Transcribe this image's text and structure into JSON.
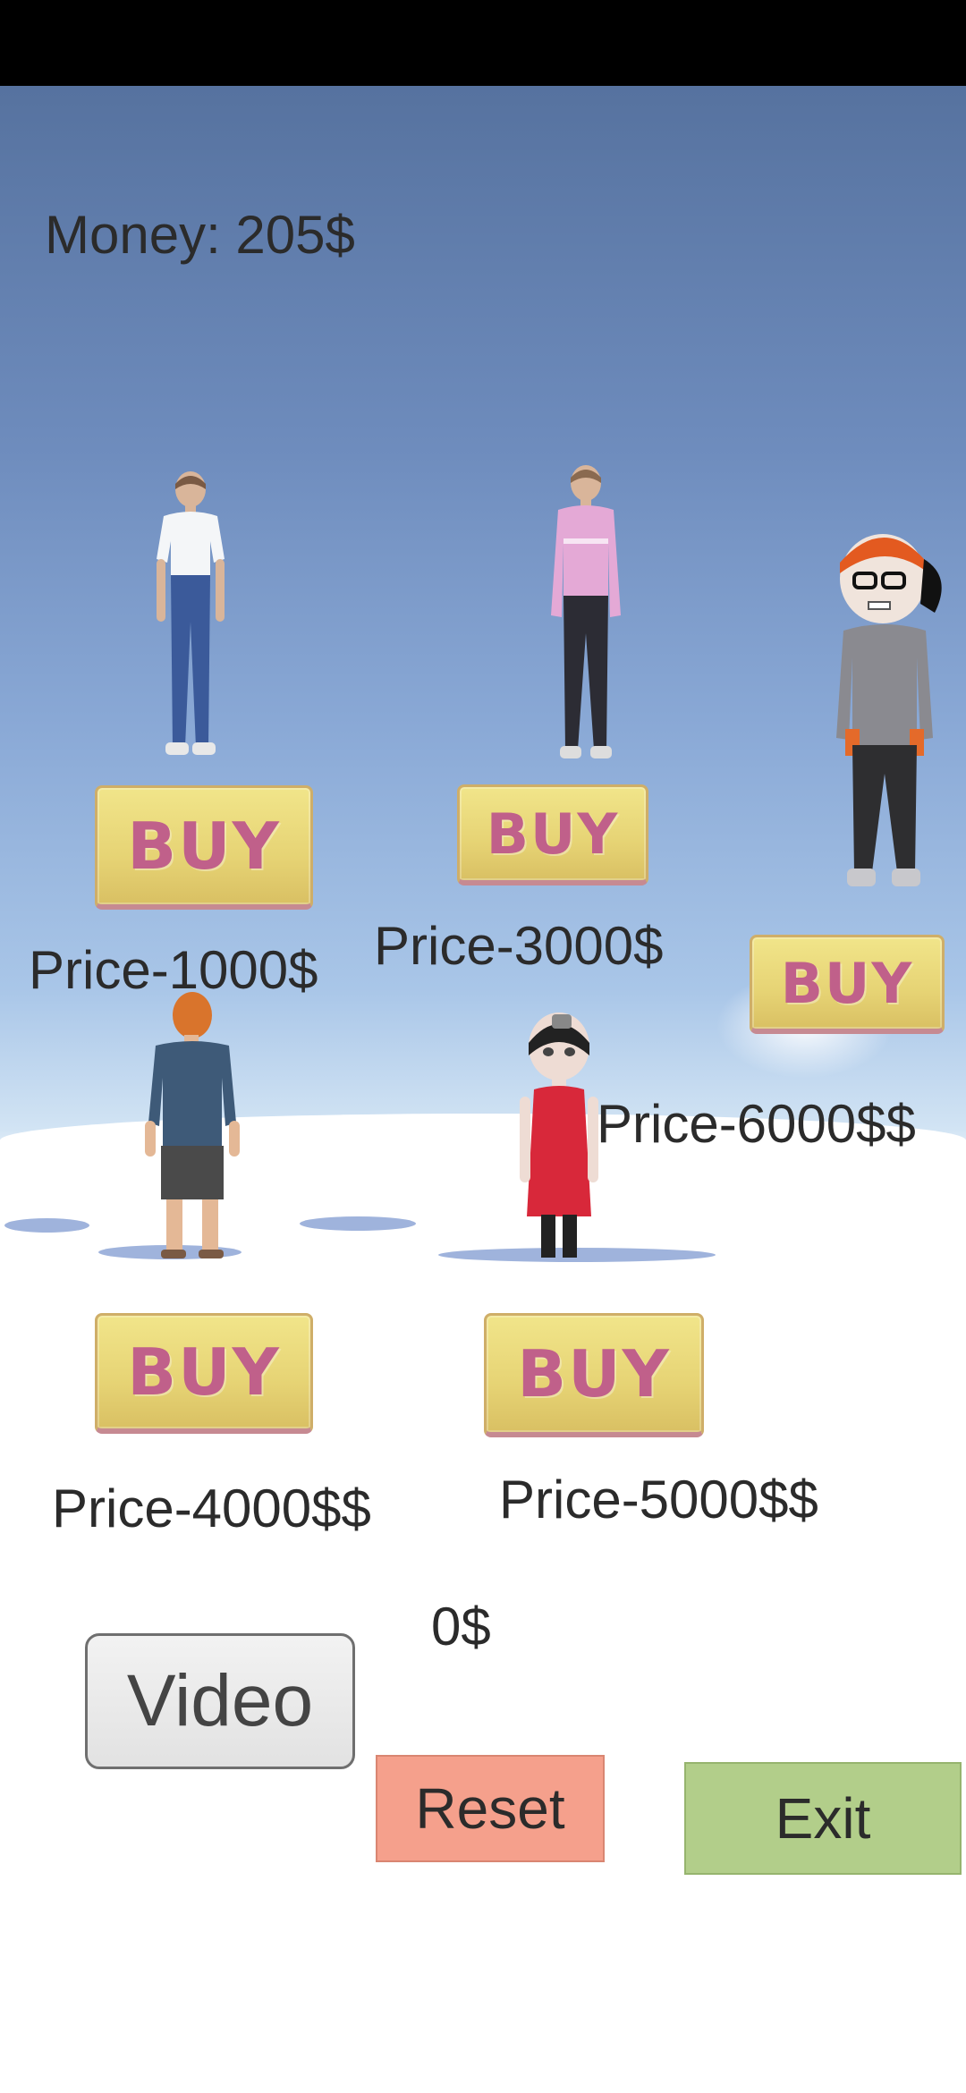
{
  "hud": {
    "money": "Money: 205$",
    "earned": "0$"
  },
  "shop": [
    {
      "buy_label": "BUY",
      "price": "Price-1000$"
    },
    {
      "buy_label": "BUY",
      "price": "Price-3000$"
    },
    {
      "buy_label": "BUY",
      "price": "Price-6000$$"
    },
    {
      "buy_label": "BUY",
      "price": "Price-4000$$"
    },
    {
      "buy_label": "BUY",
      "price": "Price-5000$$"
    }
  ],
  "buttons": {
    "video": "Video",
    "reset": "Reset",
    "exit": "Exit"
  },
  "colors": {
    "buy_bg": "#e8d676",
    "buy_text": "#c0608a",
    "reset_bg": "#f5a08c",
    "exit_bg": "#b2ce8a",
    "video_bg": "#ececec"
  }
}
